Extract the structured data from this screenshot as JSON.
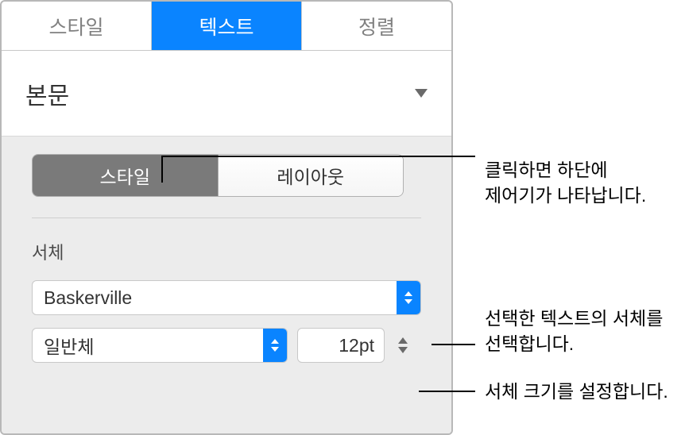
{
  "tabs": {
    "style": "스타일",
    "text": "텍스트",
    "arrange": "정렬"
  },
  "paragraph_style": {
    "selected": "본문"
  },
  "segmented": {
    "style": "스타일",
    "layout": "레이아웃"
  },
  "font": {
    "label": "서체",
    "family": "Baskerville",
    "typeface": "일반체",
    "size": "12pt"
  },
  "callouts": {
    "segmented_l1": "클릭하면 하단에",
    "segmented_l2": "제어기가 나타납니다.",
    "font_l1": "선택한 텍스트의 서체를",
    "font_l2": "선택합니다.",
    "size": "서체 크기를 설정합니다."
  }
}
